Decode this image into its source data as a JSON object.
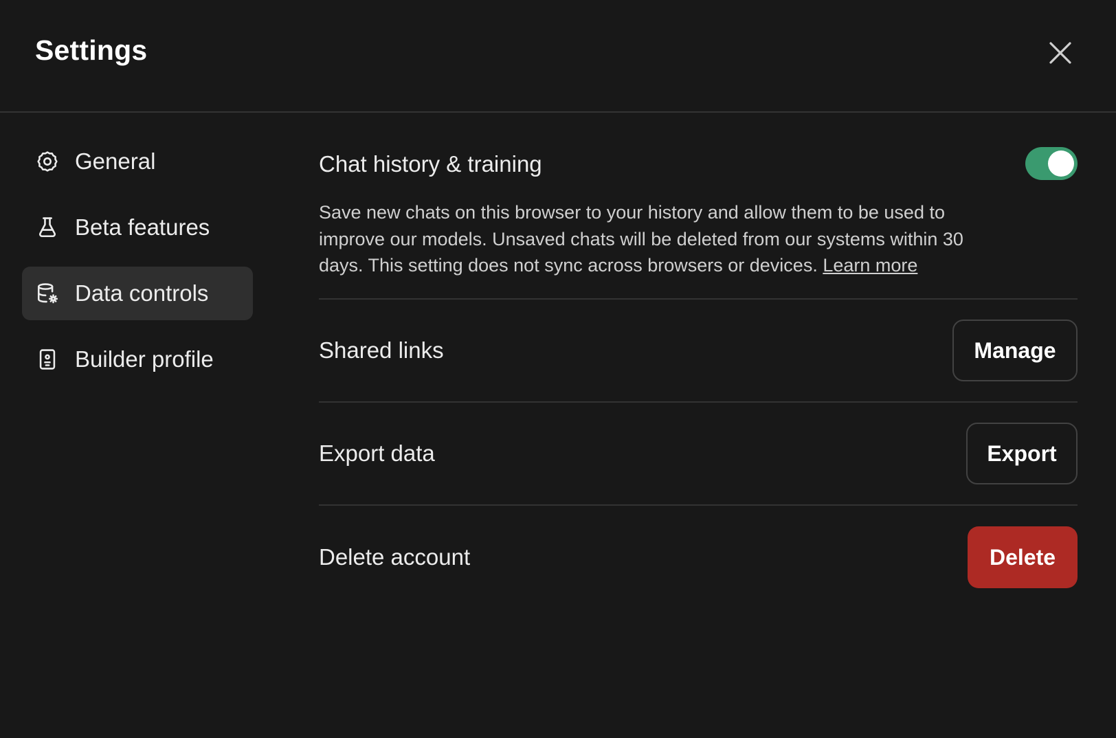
{
  "header": {
    "title": "Settings",
    "close_icon": "close-icon"
  },
  "sidebar": {
    "items": [
      {
        "label": "General",
        "icon": "gear-icon",
        "active": false
      },
      {
        "label": "Beta features",
        "icon": "flask-icon",
        "active": false
      },
      {
        "label": "Data controls",
        "icon": "database-settings-icon",
        "active": true
      },
      {
        "label": "Builder profile",
        "icon": "id-badge-icon",
        "active": false
      }
    ]
  },
  "content": {
    "chat_history": {
      "title": "Chat history & training",
      "toggle_on": true,
      "description": "Save new chats on this browser to your history and allow them to be used to improve our models. Unsaved chats will be deleted from our systems within 30 days. This setting does not sync across browsers or devices.",
      "learn_more": "Learn more"
    },
    "shared_links": {
      "label": "Shared links",
      "button": "Manage"
    },
    "export_data": {
      "label": "Export data",
      "button": "Export"
    },
    "delete_account": {
      "label": "Delete account",
      "button": "Delete"
    }
  },
  "colors": {
    "background": "#181818",
    "toggle_on": "#3a9a6f",
    "danger": "#ad2a24",
    "active_nav": "#2f2f2f",
    "divider": "#333333"
  }
}
